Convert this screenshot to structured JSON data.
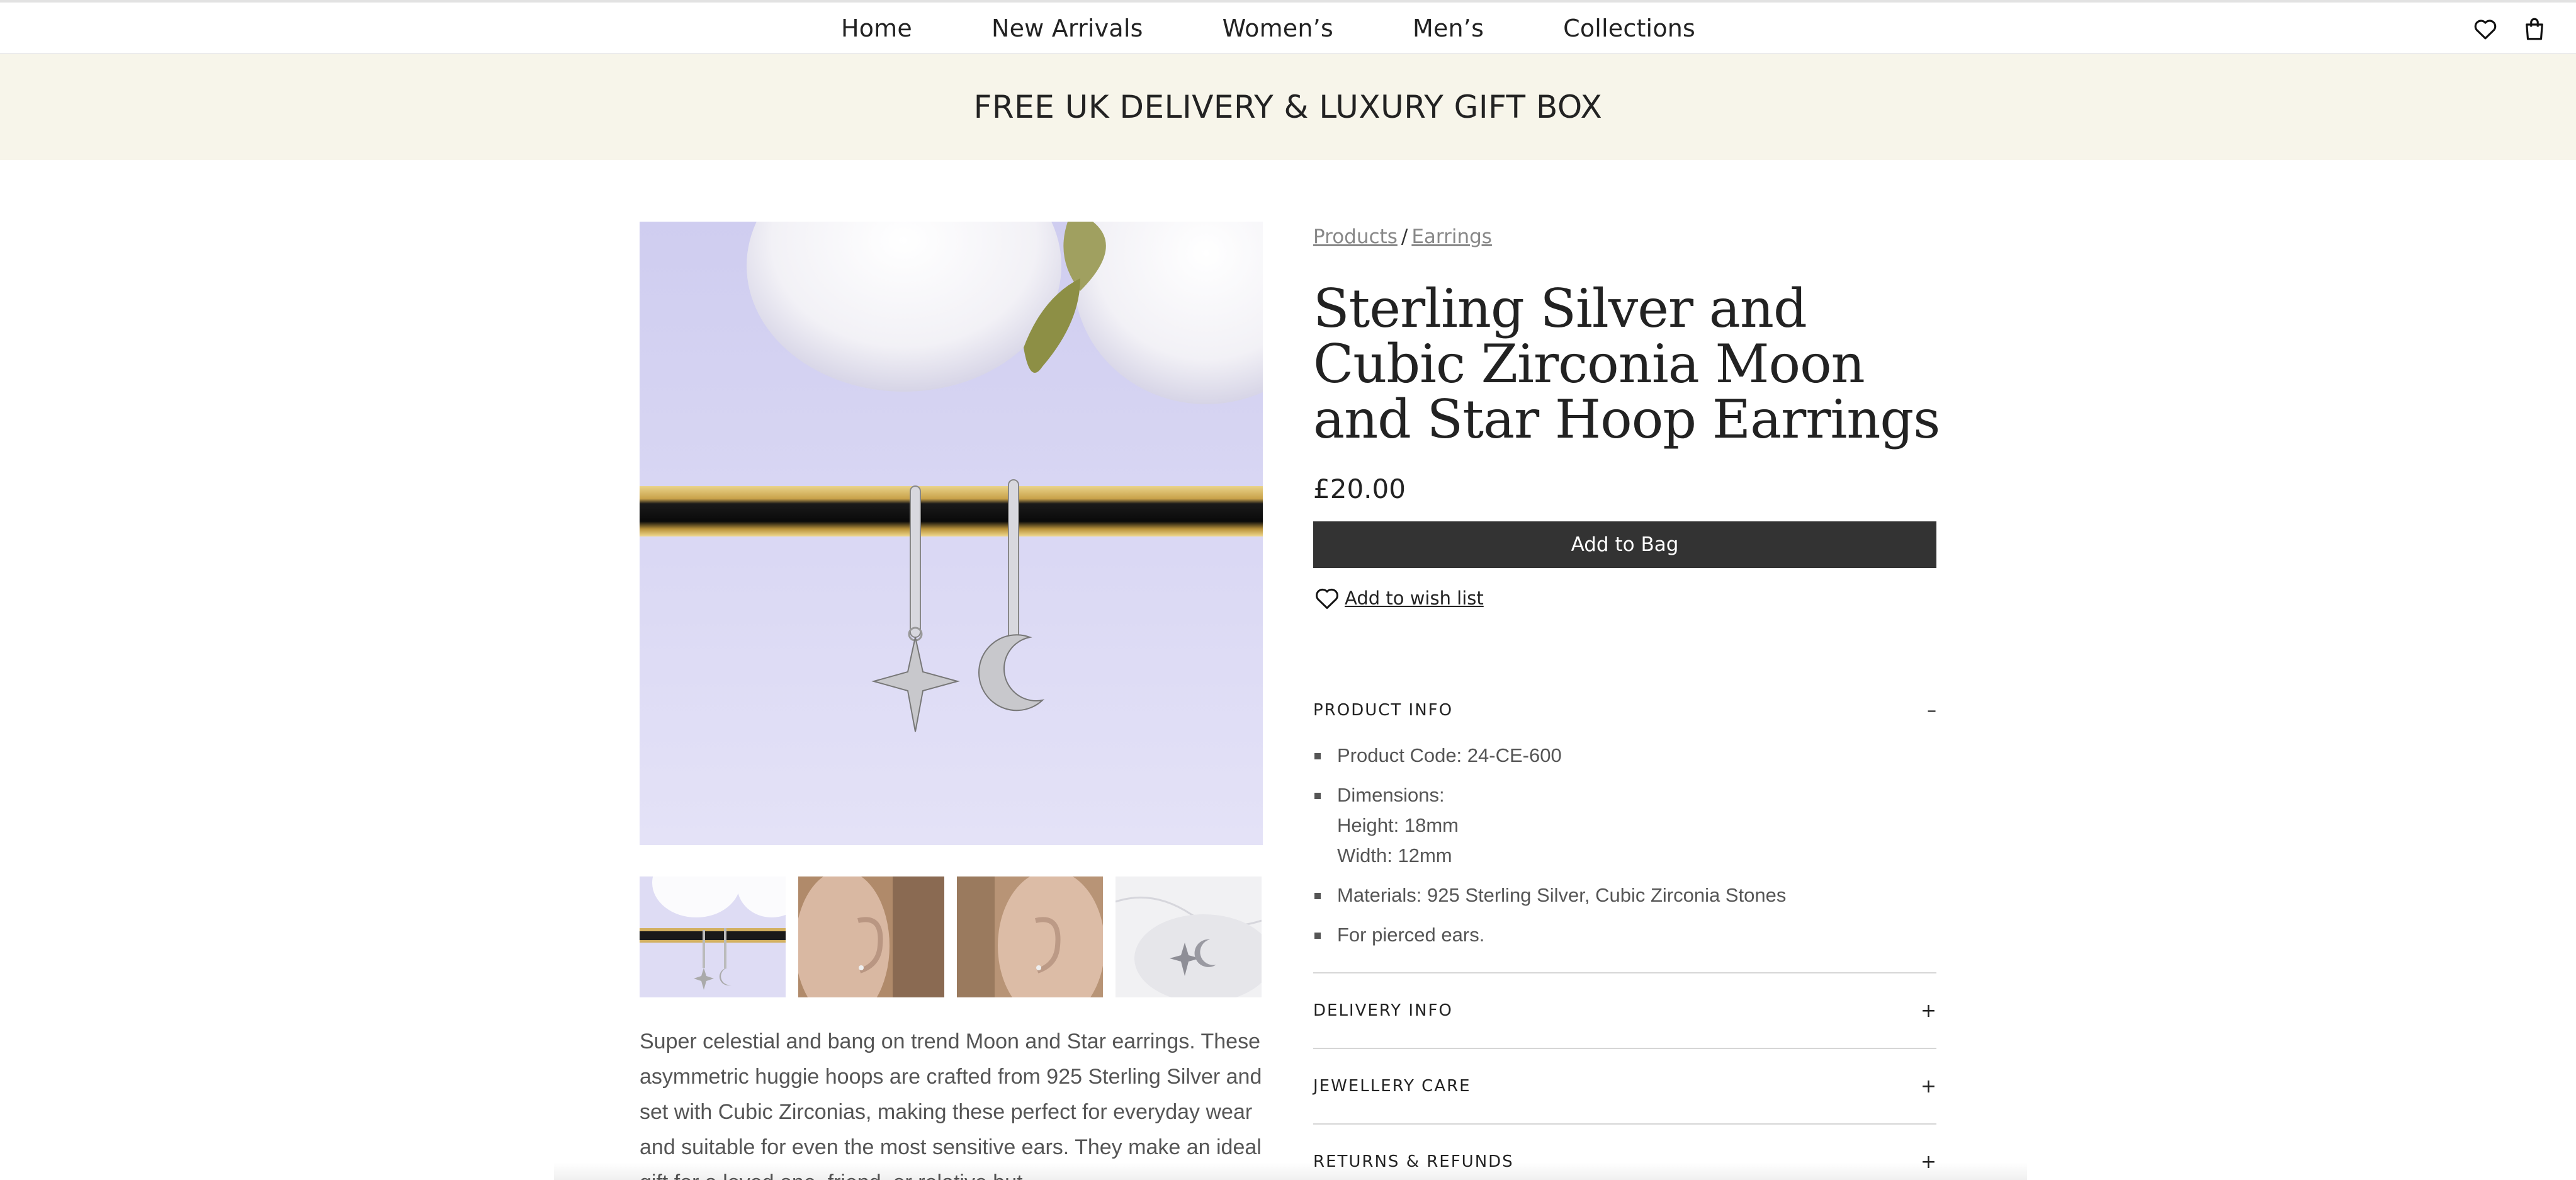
{
  "nav": {
    "links": [
      "Home",
      "New Arrivals",
      "Women’s",
      "Men’s",
      "Collections"
    ],
    "icons": [
      "heart-icon",
      "shopping-bag-icon"
    ]
  },
  "promo": {
    "text": "FREE UK DELIVERY & LUXURY GIFT BOX",
    "background": "#f7f5ea"
  },
  "breadcrumb": {
    "items": [
      "Products",
      "Earrings"
    ],
    "separator": "/"
  },
  "product": {
    "title": "Sterling Silver and Cubic Zirconia Moon and Star Hoop Earrings",
    "price": "£20.00",
    "add_to_bag_label": "Add to Bag",
    "wishlist_label": " Add to wish list",
    "description": "Super celestial and bang on trend Moon and Star earrings. These asymmetric huggie hoops are crafted from 925 Sterling Silver and set with Cubic Zirconias, making these perfect for everyday wear and suitable for even the most sensitive ears. They make an ideal gift for a loved one, friend, or relative but"
  },
  "gallery": {
    "thumbnail_count": 4
  },
  "accordion": {
    "product_info": {
      "title": "PRODUCT INFO",
      "toggle": "–",
      "items": [
        {
          "text": "Product Code: 24-CE-600"
        },
        {
          "text": "Dimensions:",
          "sub": [
            "Height: 18mm",
            "Width: 12mm"
          ]
        },
        {
          "text": "Materials: 925 Sterling Silver, Cubic Zirconia Stones"
        },
        {
          "text": "For pierced ears."
        }
      ]
    },
    "delivery_info": {
      "title": "DELIVERY INFO",
      "toggle": "+"
    },
    "jewellery_care": {
      "title": "JEWELLERY CARE",
      "toggle": "+"
    },
    "returns_refunds": {
      "title": "RETURNS & REFUNDS",
      "toggle": "+"
    }
  },
  "colors": {
    "button": "#333333",
    "image_background": "#dcdaf4"
  }
}
